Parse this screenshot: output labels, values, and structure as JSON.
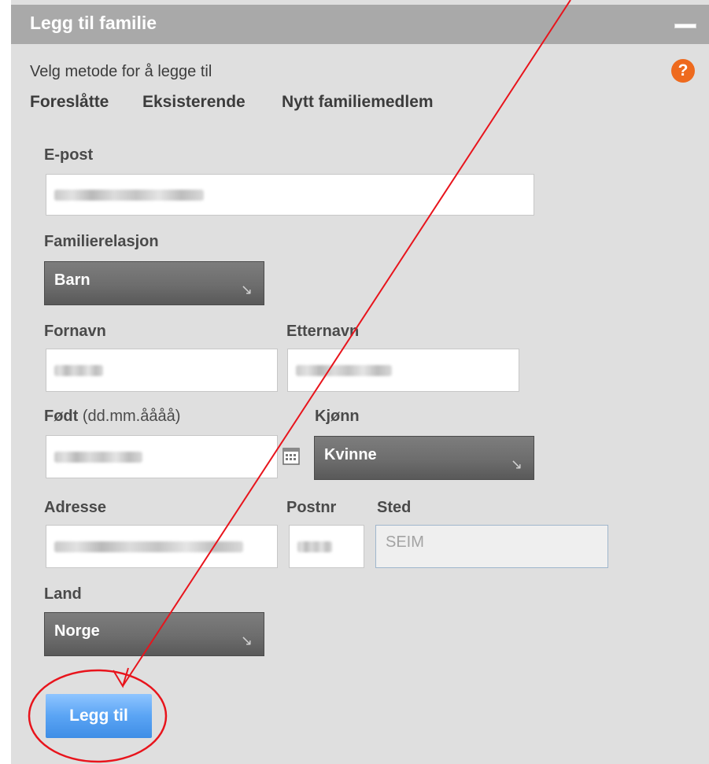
{
  "panel": {
    "title": "Legg til familie",
    "method_label": "Velg metode for å legge til",
    "help_symbol": "?",
    "tabs": [
      "Foreslåtte",
      "Eksisterende",
      "Nytt familiemedlem"
    ]
  },
  "form": {
    "email_label": "E-post",
    "relation_label": "Familierelasjon",
    "relation_value": "Barn",
    "firstname_label": "Fornavn",
    "lastname_label": "Etternavn",
    "born_label": "Født",
    "born_hint": " (dd.mm.åååå)",
    "gender_label": "Kjønn",
    "gender_value": "Kvinne",
    "address_label": "Adresse",
    "postnr_label": "Postnr",
    "place_label": "Sted",
    "place_value": "SEIM",
    "country_label": "Land",
    "country_value": "Norge",
    "submit_label": "Legg til"
  },
  "icons": {
    "dropdown": "↘",
    "calendar": "calendar-icon",
    "help": "help-icon",
    "minimize": "minimize-icon"
  },
  "colors": {
    "header": "#a9a9a9",
    "panel": "#dfdfdf",
    "help": "#ee6a1e",
    "select": "#6d6d6d",
    "submit": "#5aa4f4",
    "annotation": "#e8141c"
  }
}
